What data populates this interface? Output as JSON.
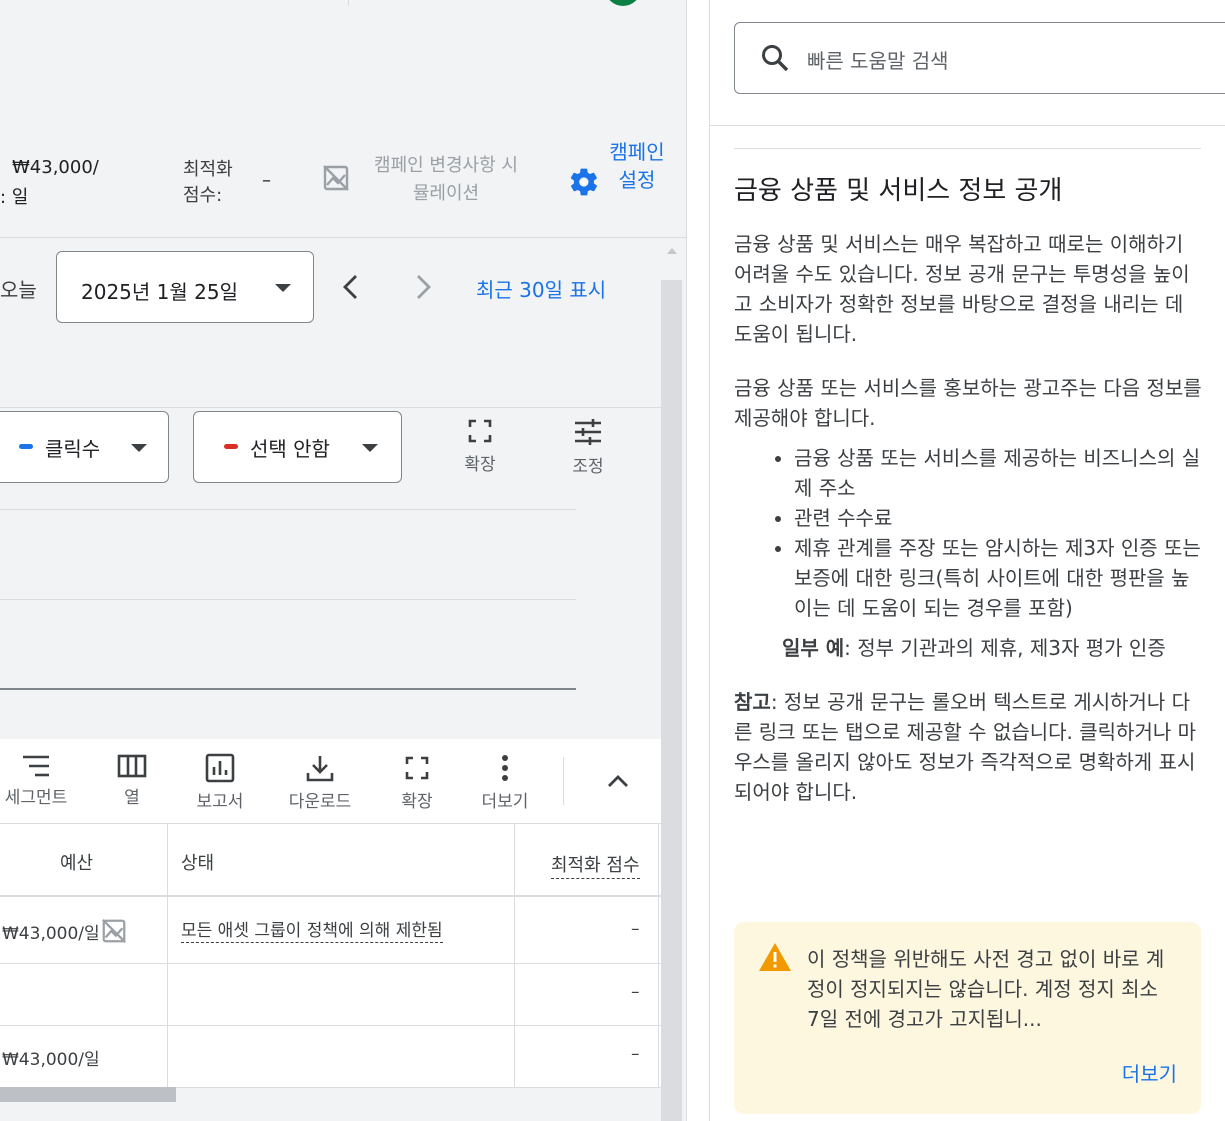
{
  "summary": {
    "budget_value": "₩43,000/",
    "budget_unit": ": 일",
    "optimization_label": "최적화 점수:",
    "optimization_value": "–",
    "simulation_label": "캠페인 변경사항 시뮬레이션",
    "campaign_settings_label": "캠페인 설정"
  },
  "date_range": {
    "today_label": "오늘",
    "selected_date": "2025년 1월 25일",
    "last30_label": "최근 30일 표시"
  },
  "chart_controls": {
    "metric1_label": "클릭수",
    "metric1_color": "#1a73e8",
    "metric2_label": "선택 안함",
    "metric2_color": "#d93025",
    "expand_label": "확장",
    "adjust_label": "조정"
  },
  "toolbar": {
    "segment_label": "세그먼트",
    "columns_label": "열",
    "reports_label": "보고서",
    "download_label": "다운로드",
    "expand_label": "확장",
    "more_label": "더보기"
  },
  "table": {
    "headers": {
      "budget": "예산",
      "status": "상태",
      "optimization": "최적화 점수"
    },
    "rows": [
      {
        "budget": "₩43,000/일",
        "status": "모든 애셋 그룹이 정책에 의해 제한됨",
        "optimization": "–"
      },
      {
        "budget": "",
        "status": "",
        "optimization": "–"
      },
      {
        "budget": "₩43,000/일",
        "status": "",
        "optimization": "–"
      }
    ]
  },
  "help": {
    "search_placeholder": "빠른 도움말 검색",
    "title": "금융 상품 및 서비스 정보 공개",
    "para1": "금융 상품 및 서비스는 매우 복잡하고 때로는 이해하기 어려울 수도 있습니다. 정보 공개 문구는 투명성을 높이고 소비자가 정확한 정보를 바탕으로 결정을 내리는 데 도움이 됩니다.",
    "para2": "금융 상품 또는 서비스를 홍보하는 광고주는 다음 정보를 제공해야 합니다.",
    "bullets": [
      "금융 상품 또는 서비스를 제공하는 비즈니스의 실제 주소",
      "관련 수수료",
      "제휴 관계를 주장 또는 암시하는 제3자 인증 또는 보증에 대한 링크(특히 사이트에 대한 평판을 높이는 데 도움이 되는 경우를 포함)"
    ],
    "example_label": "일부 예",
    "example_text": ": 정부 기관과의 제휴, 제3자 평가 인증",
    "note_label": "참고",
    "note_text": ": 정보 공개 문구는 롤오버 텍스트로 게시하거나 다른 링크 또는 탭으로 제공할 수 없습니다. 클릭하거나 마우스를 올리지 않아도 정보가 즉각적으로 명확하게 표시되어야 합니다.",
    "warning_text": "이 정책을 위반해도 사전 경고 없이 바로 계정이 정지되지는 않습니다. 계정 정지 최소 7일 전에 경고가 고지됩니...",
    "warning_more": "더보기"
  }
}
